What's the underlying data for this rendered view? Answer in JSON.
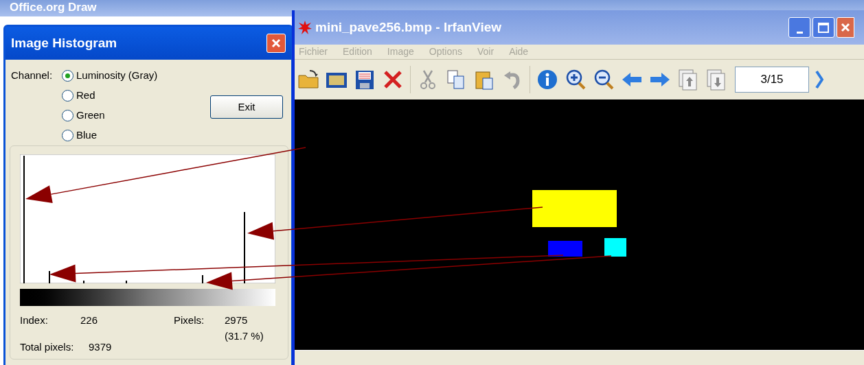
{
  "background_window": {
    "title": "Office.org Draw"
  },
  "histogram_dialog": {
    "title": "Image Histogram",
    "channel_label": "Channel:",
    "channels": [
      {
        "label": "Luminosity (Gray)",
        "selected": true
      },
      {
        "label": "Red",
        "selected": false
      },
      {
        "label": "Green",
        "selected": false
      },
      {
        "label": "Blue",
        "selected": false
      }
    ],
    "exit_button": "Exit",
    "index_label": "Index:",
    "index_value": "226",
    "pixels_label": "Pixels:",
    "pixels_value": "2975",
    "pixels_percent": "(31.7 %)",
    "total_label": "Total pixels:",
    "total_value": "9379"
  },
  "viewer_window": {
    "title": "mini_pave256.bmp - IrfanView",
    "menu": [
      {
        "label": "Fichier",
        "disabled": true
      },
      {
        "label": "Edition",
        "disabled": true
      },
      {
        "label": "Image",
        "disabled": true
      },
      {
        "label": "Options",
        "disabled": true
      },
      {
        "label": "Voir",
        "disabled": true
      },
      {
        "label": "Aide",
        "disabled": true
      }
    ],
    "page_field": "3/15"
  }
}
